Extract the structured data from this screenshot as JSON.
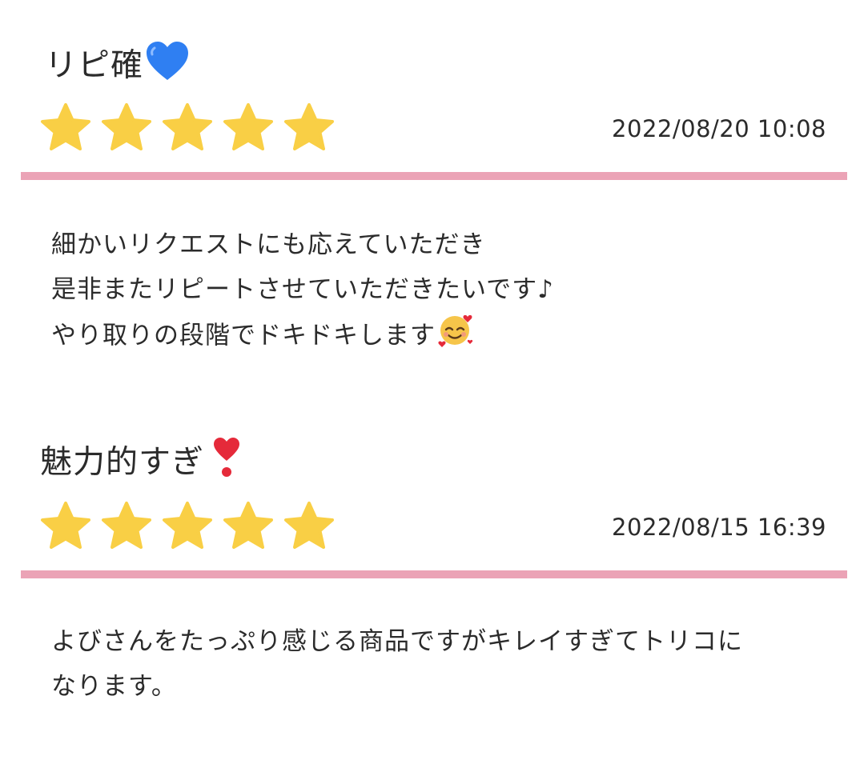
{
  "reviews": [
    {
      "title": "リピ確",
      "title_emoji": "blue-heart-icon",
      "rating": 5,
      "rating_max": 5,
      "date": "2022/08/20 10:08",
      "body_lines": [
        "細かいリクエストにも応えていただき",
        "是非またリピートさせていただきたいです♪",
        "やり取りの段階でドキドキします"
      ],
      "body_emoji": "smiling-face-with-hearts-icon"
    },
    {
      "title": "魅力的すぎ",
      "title_emoji": "red-exclamation-heart-icon",
      "rating": 5,
      "rating_max": 5,
      "date": "2022/08/15 16:39",
      "body_lines": [
        "よびさんをたっぷり感じる商品ですがキレイすぎてトリコに",
        "なります。"
      ]
    }
  ],
  "colors": {
    "star": "#f9cf45",
    "divider": "#eba3b6",
    "text": "#2b2b2b",
    "blue_heart": "#2f7ff2",
    "red_heart": "#e52a3a"
  }
}
